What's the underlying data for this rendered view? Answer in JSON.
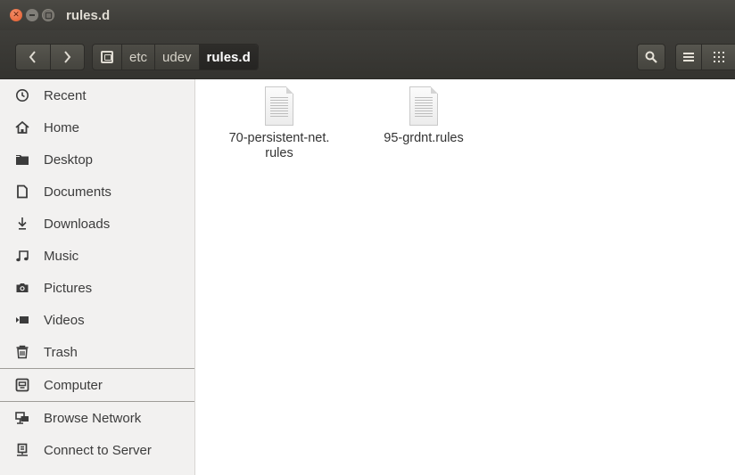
{
  "window": {
    "title": "rules.d"
  },
  "toolbar": {
    "back_icon": "chevron-left",
    "forward_icon": "chevron-right",
    "path": [
      {
        "label": "",
        "icon": "drive-icon"
      },
      {
        "label": "etc"
      },
      {
        "label": "udev"
      },
      {
        "label": "rules.d",
        "active": true
      }
    ],
    "search_icon": "search",
    "list_view_icon": "list",
    "grid_view_icon": "grid"
  },
  "sidebar": {
    "items": [
      {
        "label": "Recent",
        "icon": "clock-icon"
      },
      {
        "label": "Home",
        "icon": "home-icon"
      },
      {
        "label": "Desktop",
        "icon": "folder-icon"
      },
      {
        "label": "Documents",
        "icon": "document-icon"
      },
      {
        "label": "Downloads",
        "icon": "download-icon"
      },
      {
        "label": "Music",
        "icon": "music-icon"
      },
      {
        "label": "Pictures",
        "icon": "camera-icon"
      },
      {
        "label": "Videos",
        "icon": "video-icon"
      },
      {
        "label": "Trash",
        "icon": "trash-icon"
      }
    ],
    "devices": [
      {
        "label": "Computer",
        "icon": "drive-icon"
      }
    ],
    "network": [
      {
        "label": "Browse Network",
        "icon": "network-icon"
      },
      {
        "label": "Connect to Server",
        "icon": "server-icon"
      }
    ]
  },
  "files": [
    {
      "name": "70-persistent-net.\nrules",
      "icon": "text-file-icon"
    },
    {
      "name": "95-grdnt.rules",
      "icon": "text-file-icon"
    }
  ]
}
